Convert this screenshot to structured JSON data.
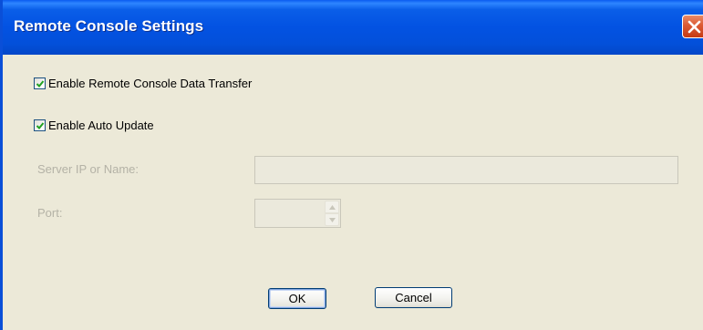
{
  "window": {
    "title": "Remote Console Settings",
    "close_icon": "close-icon"
  },
  "options": {
    "enable_data_transfer": {
      "label": "Enable Remote Console Data Transfer",
      "checked": true
    },
    "enable_auto_update": {
      "label": "Enable Auto Update",
      "checked": true
    }
  },
  "server": {
    "label": "Server IP or Name:",
    "value": "",
    "enabled": false
  },
  "port": {
    "label": "Port:",
    "value": "",
    "enabled": false
  },
  "buttons": {
    "ok_label": "OK",
    "cancel_label": "Cancel"
  },
  "colors": {
    "titlebar": "#0352e2",
    "dialog_bg": "#ece9d8",
    "disabled_text": "#b4b2a6",
    "close_button": "#dc5a34"
  }
}
